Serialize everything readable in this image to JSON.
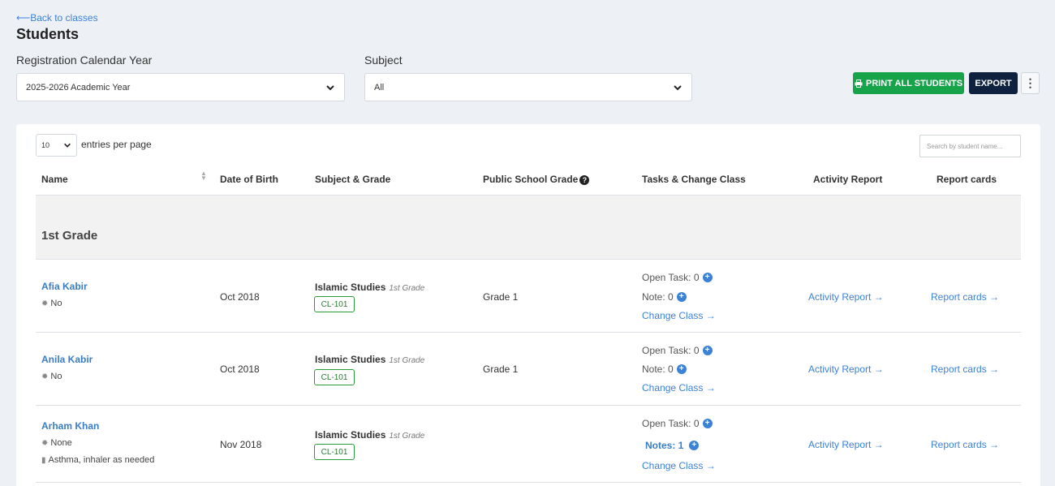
{
  "nav": {
    "back_label": "Back to classes"
  },
  "page": {
    "title": "Students"
  },
  "filters": {
    "year_label": "Registration Calendar Year",
    "year_value": "2025-2026 Academic Year",
    "subject_label": "Subject",
    "subject_value": "All"
  },
  "actions": {
    "print_label": "PRINT ALL STUDENTS",
    "export_label": "EXPORT",
    "more_label": "⋮"
  },
  "table_controls": {
    "entries_value": "10",
    "entries_label": "entries per page",
    "search_placeholder": "Search by student name..."
  },
  "columns": [
    "Name",
    "Date of Birth",
    "Subject & Grade",
    "Public School Grade",
    "Tasks & Change Class",
    "Activity Report",
    "Report cards"
  ],
  "group": {
    "label": "1st Grade"
  },
  "rows": [
    {
      "name": "Afia Kabir",
      "medical": "No",
      "allergy": "",
      "dob": "Oct 2018",
      "subject": "Islamic Studies",
      "grade_tag": "1st Grade",
      "class_code": "CL-101",
      "public_grade": "Grade 1",
      "open_task": "Open Task: 0",
      "note": "Note: 0",
      "change_class": "Change Class →",
      "activity": "Activity Report →",
      "report": "Report cards →"
    },
    {
      "name": "Anila Kabir",
      "medical": "No",
      "allergy": "",
      "dob": "Oct 2018",
      "subject": "Islamic Studies",
      "grade_tag": "1st Grade",
      "class_code": "CL-101",
      "public_grade": "Grade 1",
      "open_task": "Open Task: 0",
      "note": "Note: 0",
      "change_class": "Change Class →",
      "activity": "Activity Report →",
      "report": "Report cards →"
    },
    {
      "name": "Arham Khan",
      "medical": "None",
      "allergy": "Asthma, inhaler as needed",
      "dob": "Nov 2018",
      "subject": "Islamic Studies",
      "grade_tag": "1st Grade",
      "class_code": "CL-101",
      "public_grade": "",
      "open_task": "Open Task: 0",
      "note": "Notes: 1",
      "change_class": "Change Class →",
      "activity": "Activity Report →",
      "report": "Report cards →"
    }
  ],
  "colors": {
    "accent": "#3b82d6",
    "print_button": "#16a34a",
    "export_button": "#0e2240",
    "badge_border": "#2a9a3a"
  }
}
